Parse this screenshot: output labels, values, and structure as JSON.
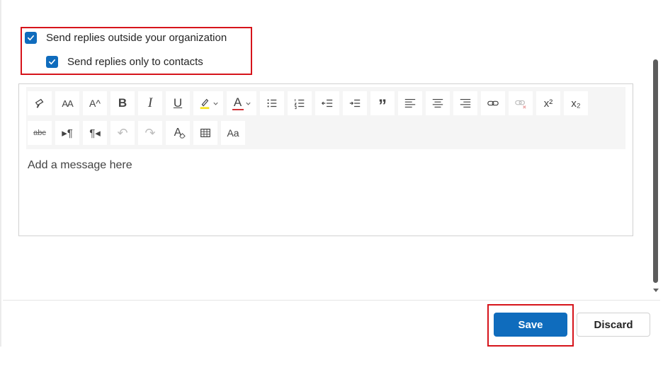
{
  "options": {
    "outside_org": {
      "label": "Send replies outside your organization",
      "checked": true
    },
    "only_contacts": {
      "label": "Send replies only to contacts",
      "checked": true
    }
  },
  "editor": {
    "placeholder": "Add a message here",
    "toolbar": {
      "row1": [
        {
          "name": "format-painter-icon",
          "glyph": ""
        },
        {
          "name": "font-size-icon",
          "glyph": "AA"
        },
        {
          "name": "grow-font-icon",
          "glyph": "A^"
        },
        {
          "name": "bold-icon",
          "glyph": "B"
        },
        {
          "name": "italic-icon",
          "glyph": "I"
        },
        {
          "name": "underline-icon",
          "glyph": "U"
        },
        {
          "name": "highlight-icon",
          "glyph": ""
        },
        {
          "name": "font-color-icon",
          "glyph": "A"
        },
        {
          "name": "bullets-icon",
          "glyph": ""
        },
        {
          "name": "numbering-icon",
          "glyph": ""
        },
        {
          "name": "decrease-indent-icon",
          "glyph": ""
        },
        {
          "name": "increase-indent-icon",
          "glyph": ""
        },
        {
          "name": "quote-icon",
          "glyph": "”"
        },
        {
          "name": "align-left-icon",
          "glyph": ""
        },
        {
          "name": "align-center-icon",
          "glyph": ""
        },
        {
          "name": "align-right-icon",
          "glyph": ""
        },
        {
          "name": "link-icon",
          "glyph": ""
        },
        {
          "name": "unlink-icon",
          "glyph": ""
        },
        {
          "name": "superscript-icon",
          "glyph": "x²"
        },
        {
          "name": "subscript-icon",
          "glyph": "x₂"
        }
      ],
      "row2": [
        {
          "name": "strikethrough-icon",
          "glyph": "abc"
        },
        {
          "name": "ltr-icon",
          "glyph": "▸¶"
        },
        {
          "name": "rtl-icon",
          "glyph": "¶◂"
        },
        {
          "name": "undo-icon",
          "glyph": "↶"
        },
        {
          "name": "redo-icon",
          "glyph": "↷"
        },
        {
          "name": "clear-formatting-icon",
          "glyph": "A"
        },
        {
          "name": "table-icon",
          "glyph": ""
        },
        {
          "name": "change-case-icon",
          "glyph": "Aa"
        }
      ]
    }
  },
  "actions": {
    "save_label": "Save",
    "discard_label": "Discard"
  },
  "colors": {
    "accent": "#0f6cbd",
    "highlight_border": "#d6141b",
    "highlighter_yellow": "#f7e31a",
    "font_color_red": "#d13438"
  }
}
